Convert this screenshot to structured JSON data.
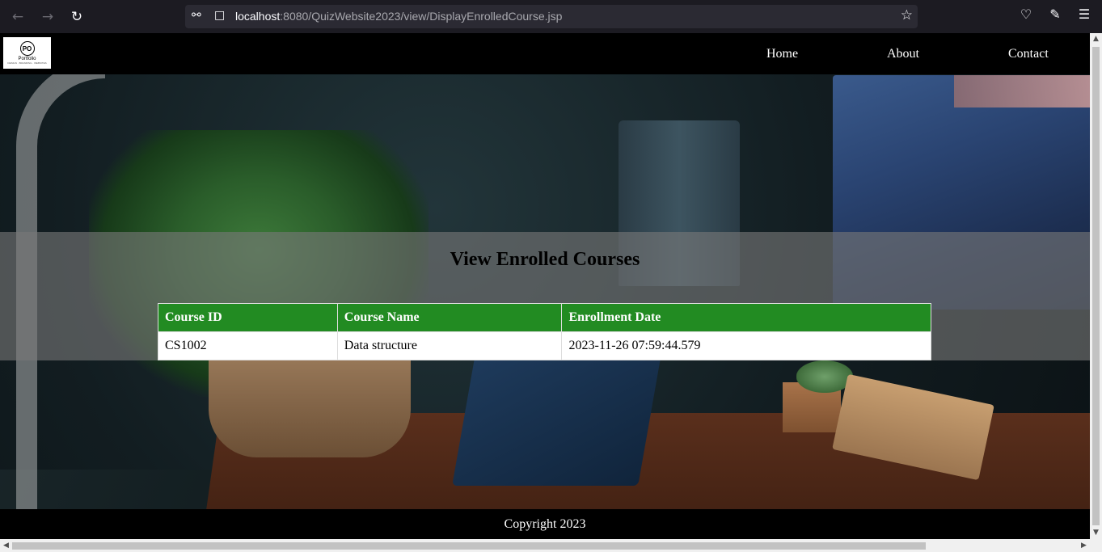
{
  "browser": {
    "url_host": "localhost",
    "url_path": ":8080/QuizWebsite2023/view/DisplayEnrolledCourse.jsp",
    "icons": {
      "back": "back-arrow-icon",
      "forward": "forward-arrow-icon",
      "reload": "reload-icon",
      "shield": "shield-icon",
      "page": "page-icon",
      "bookmark": "star-icon",
      "pocket": "pocket-icon",
      "extensions": "extensions-icon",
      "menu": "hamburger-menu-icon"
    }
  },
  "header": {
    "logo": {
      "mark": "PO",
      "text": "Portfolio",
      "subtitle": "DESIGN · BRANDING · WEBSITES"
    },
    "nav": [
      {
        "label": "Home"
      },
      {
        "label": "About"
      },
      {
        "label": "Contact"
      }
    ]
  },
  "main": {
    "title": "View Enrolled Courses",
    "table": {
      "columns": [
        "Course ID",
        "Course Name",
        "Enrollment Date"
      ],
      "rows": [
        [
          "CS1002",
          "Data structure",
          "2023-11-26 07:59:44.579"
        ]
      ]
    }
  },
  "footer": {
    "copyright": "Copyright 2023"
  },
  "colors": {
    "header_bg": "#000000",
    "table_header_bg": "#228b22",
    "band_bg": "rgba(120,120,120,0.62)"
  }
}
